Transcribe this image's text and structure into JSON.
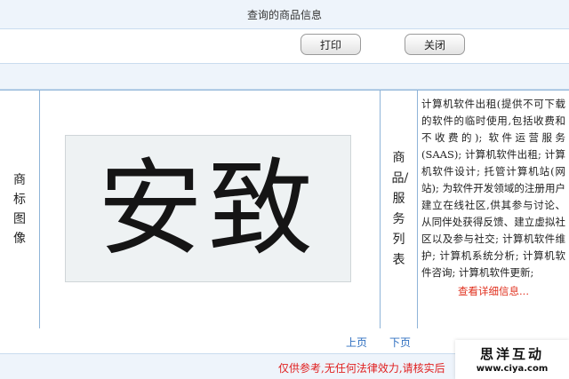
{
  "window": {
    "title": "查询的商品信息"
  },
  "toolbar": {
    "print_label": "打印",
    "close_label": "关闭"
  },
  "labels": {
    "trademark_image": "商标图像",
    "goods_services_list": "商品/服务列表"
  },
  "trademark": {
    "image_text": "安致"
  },
  "goods_services": {
    "description": "计算机软件出租(提供不可下载的软件的临时使用,包括收费和不收费的); 软件运营服务(SAAS); 计算机软件出租; 计算机软件设计; 托管计算机站(网站); 为软件开发领域的注册用户建立在线社区,供其参与讨论、从同伴处获得反馈、建立虚拟社区以及参与社交; 计算机软件维护; 计算机系统分析; 计算机软件咨询; 计算机软件更新;",
    "more_link": "查看详细信息..."
  },
  "pager": {
    "prev": "上页",
    "next": "下页"
  },
  "footer": {
    "disclaimer": "仅供参考,无任何法律效力,请核实后"
  },
  "watermark": {
    "brand": "思洋互动",
    "url": "www.ciya.com"
  },
  "colors": {
    "header_bg": "#eef4fb",
    "border": "#8fb4d8",
    "link_blue": "#2f6fc0",
    "alert_red": "#e0301e"
  }
}
